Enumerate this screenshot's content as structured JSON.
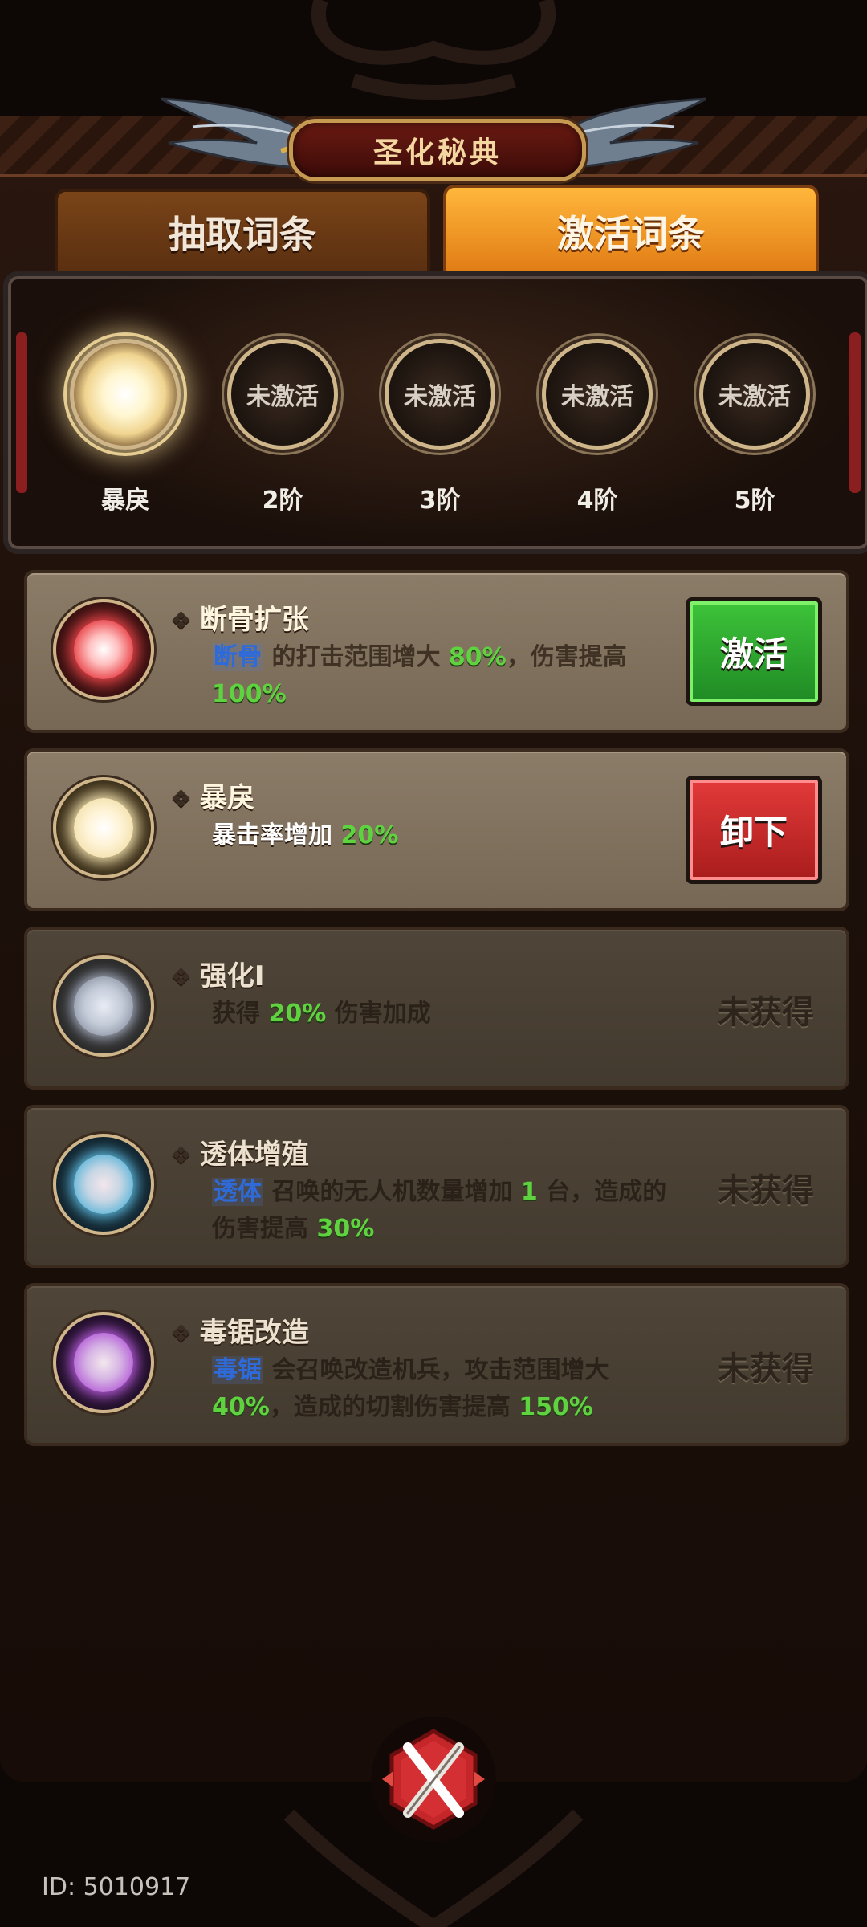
{
  "title": "圣化秘典",
  "tabs": [
    {
      "label": "抽取词条",
      "active": false
    },
    {
      "label": "激活词条",
      "active": true
    }
  ],
  "stages": [
    {
      "ring_text": "",
      "label": "暴戾",
      "lit": true
    },
    {
      "ring_text": "未激活",
      "label": "2阶"
    },
    {
      "ring_text": "未激活",
      "label": "3阶"
    },
    {
      "ring_text": "未激活",
      "label": "4阶"
    },
    {
      "ring_text": "未激活",
      "label": "5阶"
    }
  ],
  "entries": [
    {
      "name": "断骨扩张",
      "desc": {
        "kw": "断骨",
        "t1": " 的打击范围增大 ",
        "n1": "80%",
        "t2": "，伤害提高",
        "n2": "100%"
      },
      "action": "激活",
      "orb_color": "#e8454a"
    },
    {
      "name": "暴戾",
      "desc": {
        "w": "暴击率增加",
        "n1": "20%"
      },
      "action": "卸下",
      "orb_color": "#f3e2b0"
    },
    {
      "name": "强化I",
      "desc": {
        "t1": "获得 ",
        "n1": "20%",
        "t2": " 伤害加成"
      },
      "status": "未获得",
      "orb_color": "#b9c2d6"
    },
    {
      "name": "透体增殖",
      "desc": {
        "kw": "透体",
        "t1": " 召唤的无人机数量增加 ",
        "n1": "1",
        "t2": " 台，造成的伤害提高 ",
        "n2": "30%"
      },
      "status": "未获得",
      "orb_color": "#5ab4d8"
    },
    {
      "name": "毒锯改造",
      "desc": {
        "kw": "毒锯",
        "t1": " 会召唤改造机兵，攻击范围增大 ",
        "n1": "40%",
        "t2": "，造成的切割伤害提高 ",
        "n2": "150%"
      },
      "status": "未获得",
      "orb_color": "#b35ad6"
    }
  ],
  "footer": {
    "id_text": "ID: 5010917"
  },
  "colors": {
    "accent_orange": "#e07a14",
    "active_green": "#1f8a24",
    "remove_red": "#a91c1c",
    "value_green": "#5fd33f"
  }
}
